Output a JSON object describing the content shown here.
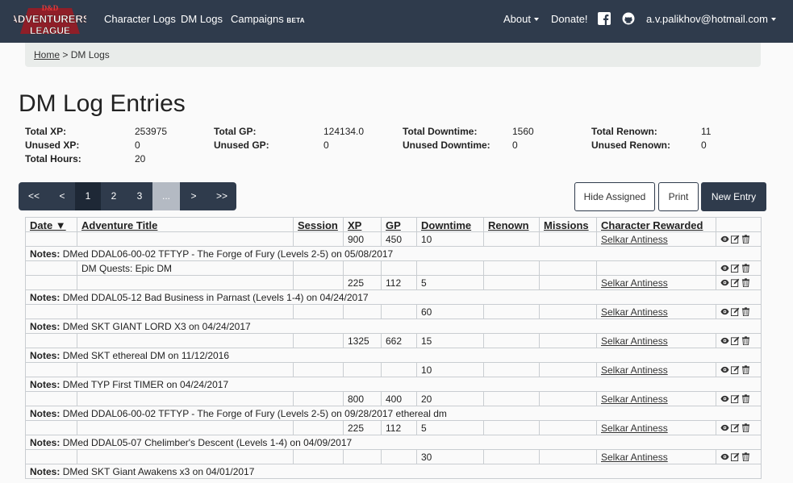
{
  "navbar": {
    "logo_text_top": "D&D",
    "logo_text_mid": "ADVENTURERS",
    "logo_text_bot": "LEAGUE",
    "links": [
      "Character Logs",
      "DM Logs",
      "Campaigns"
    ],
    "campaigns_badge": "BETA",
    "about": "About",
    "donate": "Donate!",
    "user": "a.v.palikhov@hotmail.com"
  },
  "breadcrumb": {
    "home": "Home",
    "separator": ">",
    "current": "DM Logs"
  },
  "page_title": "DM Log Entries",
  "summary": {
    "total_xp_label": "Total XP:",
    "total_xp": "253975",
    "unused_xp_label": "Unused XP:",
    "unused_xp": "0",
    "total_hours_label": "Total Hours:",
    "total_hours": "20",
    "total_gp_label": "Total GP:",
    "total_gp": "124134.0",
    "unused_gp_label": "Unused GP:",
    "unused_gp": "0",
    "total_downtime_label": "Total Downtime:",
    "total_downtime": "1560",
    "unused_downtime_label": "Unused Downtime:",
    "unused_downtime": "0",
    "total_renown_label": "Total Renown:",
    "total_renown": "11",
    "unused_renown_label": "Unused Renown:",
    "unused_renown": "0"
  },
  "pagination": [
    "<<",
    "<",
    "1",
    "2",
    "3",
    "...",
    ">",
    ">>"
  ],
  "buttons": {
    "hide_assigned": "Hide Assigned",
    "print": "Print",
    "new_entry": "New Entry"
  },
  "table": {
    "headers": {
      "date": "Date ▼",
      "adventure": "Adventure Title",
      "session": "Session",
      "xp": "XP",
      "gp": "GP",
      "downtime": "Downtime",
      "renown": "Renown",
      "missions": "Missions",
      "character": "Character Rewarded"
    },
    "notes_label": "Notes:",
    "rows": [
      {
        "adventure": "",
        "xp": "900",
        "gp": "450",
        "downtime": "10",
        "character": "Selkar Antiness"
      },
      {
        "note": "DMed DDAL06-00-02 TFTYP - The Forge of Fury (Levels 2-5) on 05/08/2017"
      },
      {
        "adventure": "DM Quests: Epic DM",
        "xp": "",
        "gp": "",
        "downtime": "",
        "character": ""
      },
      {
        "adventure": "",
        "xp": "225",
        "gp": "112",
        "downtime": "5",
        "character": "Selkar Antiness"
      },
      {
        "note": "DMed DDAL05-12 Bad Business in Parnast (Levels 1-4) on 04/24/2017"
      },
      {
        "adventure": "",
        "xp": "",
        "gp": "",
        "downtime": "60",
        "character": "Selkar Antiness"
      },
      {
        "note": "DMed SKT GIANT LORD X3 on 04/24/2017"
      },
      {
        "adventure": "",
        "xp": "1325",
        "gp": "662",
        "downtime": "15",
        "character": "Selkar Antiness"
      },
      {
        "note": "DMed SKT ethereal DM on 11/12/2016"
      },
      {
        "adventure": "",
        "xp": "",
        "gp": "",
        "downtime": "10",
        "character": "Selkar Antiness"
      },
      {
        "note": "DMed TYP First TIMER on 04/24/2017"
      },
      {
        "adventure": "",
        "xp": "800",
        "gp": "400",
        "downtime": "20",
        "character": "Selkar Antiness"
      },
      {
        "note": "DMed DDAL06-00-02 TFTYP - The Forge of Fury (Levels 2-5) on 09/28/2017 ethereal dm"
      },
      {
        "adventure": "",
        "xp": "225",
        "gp": "112",
        "downtime": "5",
        "character": "Selkar Antiness"
      },
      {
        "note": "DMed DDAL05-07 Chelimber's Descent (Levels 1-4) on 04/09/2017"
      },
      {
        "adventure": "",
        "xp": "",
        "gp": "",
        "downtime": "30",
        "character": "Selkar Antiness"
      },
      {
        "note": "DMed SKT Giant Awakens x3 on 04/01/2017"
      }
    ]
  },
  "icons": {
    "view": "eye-icon",
    "edit": "edit-icon",
    "delete": "trash-icon",
    "facebook": "facebook-icon",
    "github": "github-icon"
  },
  "colors": {
    "navbar": "#2f3b4c",
    "logo_red": "#c0202a"
  }
}
